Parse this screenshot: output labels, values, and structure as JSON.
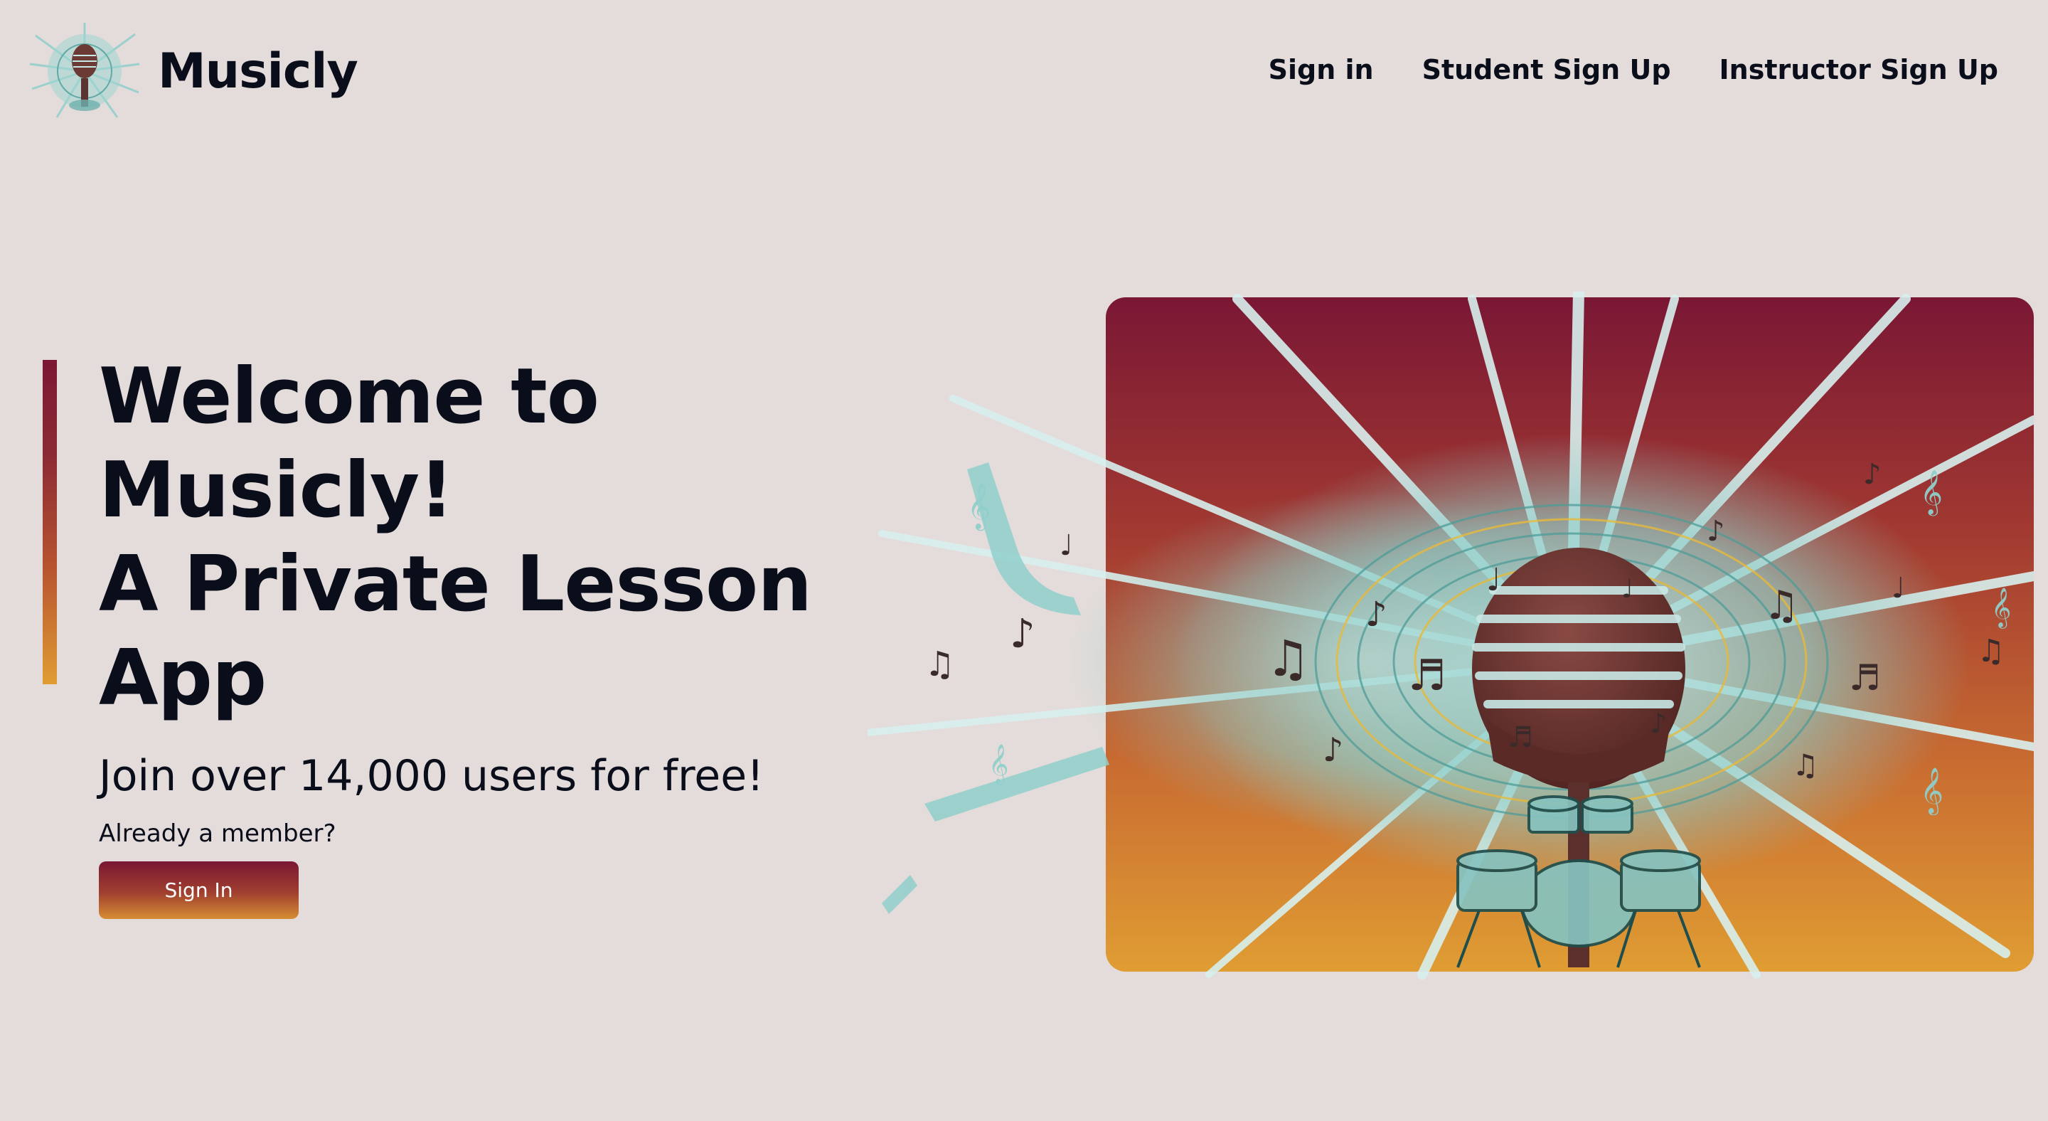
{
  "brand": {
    "name": "Musicly",
    "logo_icon": "microphone-burst-logo"
  },
  "nav": {
    "items": [
      {
        "label": "Sign in"
      },
      {
        "label": "Student Sign Up"
      },
      {
        "label": "Instructor Sign Up"
      }
    ]
  },
  "hero": {
    "title_lines": [
      "Welcome to",
      "Musicly!",
      "A Private Lesson",
      "App"
    ],
    "subheading": "Join over 14,000 users for free!",
    "member_prompt": "Already a member?",
    "signin_button": "Sign In",
    "image_icon": "microphone-drums-music-burst-illustration"
  },
  "colors": {
    "background": "#e3dcda",
    "text": "#0a0d1a",
    "gradient_top": "#7a1734",
    "gradient_bottom": "#e09d33",
    "accent_teal": "#8fcfcb"
  }
}
